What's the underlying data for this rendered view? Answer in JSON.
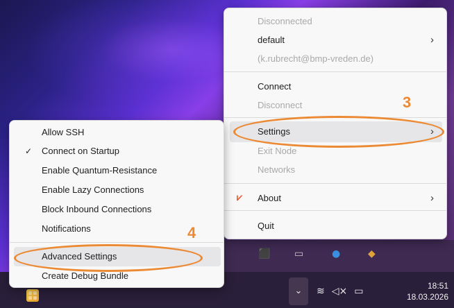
{
  "main_menu": {
    "status": "Disconnected",
    "profile": "default",
    "account": "(k.rubrecht@bmp-vreden.de)",
    "connect": "Connect",
    "disconnect": "Disconnect",
    "settings": "Settings",
    "exit_node": "Exit Node",
    "networks": "Networks",
    "about": "About",
    "quit": "Quit"
  },
  "settings_submenu": {
    "items": [
      {
        "label": "Allow SSH",
        "checked": false
      },
      {
        "label": "Connect on Startup",
        "checked": true
      },
      {
        "label": "Enable Quantum-Resistance",
        "checked": false
      },
      {
        "label": "Enable Lazy Connections",
        "checked": false
      },
      {
        "label": "Block Inbound Connections",
        "checked": false
      },
      {
        "label": "Notifications",
        "checked": false
      },
      {
        "label": "Advanced Settings",
        "checked": false
      },
      {
        "label": "Create Debug Bundle",
        "checked": false
      }
    ]
  },
  "annotations": {
    "step_3": "3",
    "step_4": "4",
    "color": "#ec8a34"
  },
  "taskbar": {
    "time": "18:51",
    "date": "18.03.2026"
  },
  "icons": {
    "chevron": "chevron-right-icon",
    "check": "check-icon",
    "about": "netbird-logo-icon",
    "tray": [
      "chevron-up-icon",
      "wifi-icon",
      "speaker-muted-icon",
      "battery-icon"
    ]
  }
}
